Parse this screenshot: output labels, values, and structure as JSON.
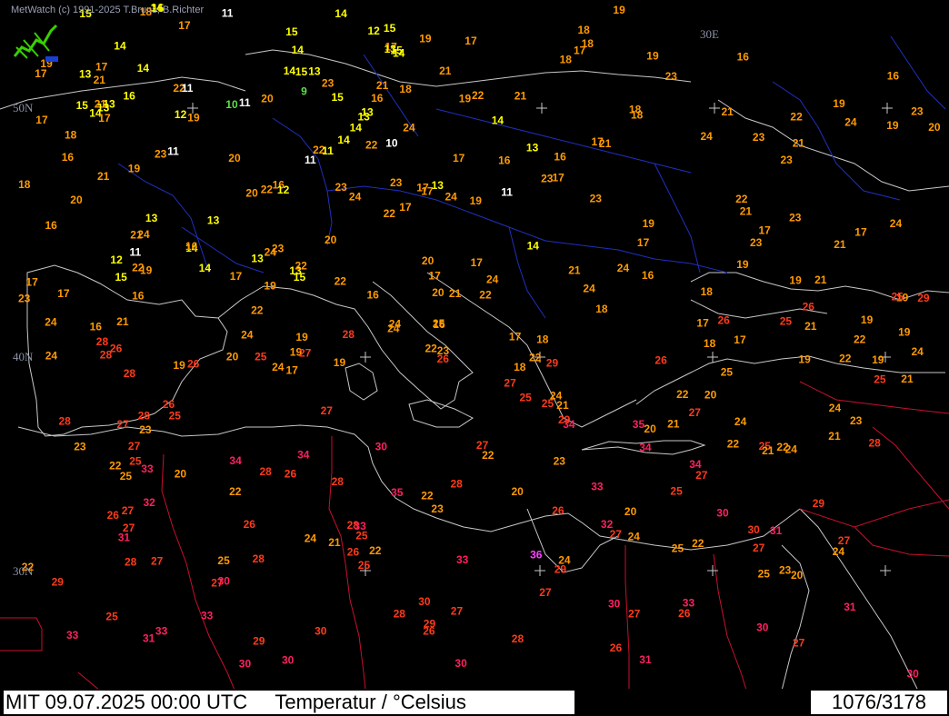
{
  "credit": "MetWatch  (c) 1991-2025 T.Bruns, B.Richter",
  "grid_labels": {
    "lon_30e": "30E",
    "lat_50n": "50N",
    "lat_40n": "40N",
    "lat_30n": "30N"
  },
  "footer": {
    "run_text": "MIT 09.07.2025 00:00 UTC     Temperatur / °Celsius",
    "count": "1076/3178"
  },
  "colors": {
    "background": "#000000",
    "coastline": "#c8c8c8",
    "borders_africa": "#c8102e",
    "borders_europe": "#2030c0",
    "temp_le_10": "#ffffff",
    "temp_green": "#5be04a",
    "temp_10_15": "#ffff00",
    "temp_16_19": "#ff9a00",
    "temp_20_24": "#ff8a00",
    "temp_25_29": "#ff3a1a",
    "temp_30_34": "#ff2060",
    "temp_ge_35": "#ff40ff"
  },
  "temperatures": [
    {
      "v": "11",
      "c": "w"
    },
    {
      "v": "16",
      "c": "y"
    },
    {
      "v": "17",
      "c": "o"
    },
    {
      "v": "16",
      "c": "o"
    },
    {
      "v": "16",
      "c": "o"
    },
    {
      "v": "13",
      "c": "y"
    },
    {
      "v": "15",
      "c": "y"
    },
    {
      "v": "13",
      "c": "y"
    },
    {
      "v": "15",
      "c": "y"
    },
    {
      "v": "14",
      "c": "y"
    },
    {
      "v": "17",
      "c": "o"
    },
    {
      "v": "19",
      "c": "o"
    },
    {
      "v": "19",
      "c": "o"
    },
    {
      "v": "16",
      "c": "o"
    },
    {
      "v": "17",
      "c": "o"
    },
    {
      "v": "18",
      "c": "o"
    },
    {
      "v": "19",
      "c": "o"
    },
    {
      "v": "14",
      "c": "y"
    },
    {
      "v": "15",
      "c": "y"
    },
    {
      "v": "13",
      "c": "y"
    },
    {
      "v": "11",
      "c": "w"
    },
    {
      "v": "12",
      "c": "y"
    },
    {
      "v": "14",
      "c": "y"
    },
    {
      "v": "15",
      "c": "y"
    },
    {
      "v": "13",
      "c": "y"
    },
    {
      "v": "13",
      "c": "y"
    },
    {
      "v": "14",
      "c": "y"
    },
    {
      "v": "15",
      "c": "y"
    },
    {
      "v": "16",
      "c": "o"
    },
    {
      "v": "17",
      "c": "o"
    },
    {
      "v": "19",
      "c": "o"
    },
    {
      "v": "17",
      "c": "o"
    },
    {
      "v": "22",
      "c": "o"
    },
    {
      "v": "20",
      "c": "o"
    },
    {
      "v": "22",
      "c": "o"
    },
    {
      "v": "24",
      "c": "o"
    },
    {
      "v": "19",
      "c": "o"
    },
    {
      "v": "19",
      "c": "o"
    },
    {
      "v": "19",
      "c": "o"
    },
    {
      "v": "20",
      "c": "o"
    },
    {
      "v": "14",
      "c": "y"
    },
    {
      "v": "10",
      "c": "g"
    },
    {
      "v": "12",
      "c": "y"
    },
    {
      "v": "16",
      "c": "o"
    },
    {
      "v": "14",
      "c": "y"
    },
    {
      "v": "15",
      "c": "y"
    },
    {
      "v": "14",
      "c": "y"
    },
    {
      "v": "15",
      "c": "y"
    },
    {
      "v": "16",
      "c": "o"
    },
    {
      "v": "17",
      "c": "o"
    },
    {
      "v": "16",
      "c": "o"
    },
    {
      "v": "19",
      "c": "o"
    },
    {
      "v": "19",
      "c": "o"
    },
    {
      "v": "21",
      "c": "o"
    },
    {
      "v": "20",
      "c": "o"
    },
    {
      "v": "22",
      "c": "o"
    },
    {
      "v": "22",
      "c": "o"
    },
    {
      "v": "21",
      "c": "o"
    },
    {
      "v": "20",
      "c": "o"
    },
    {
      "v": "21",
      "c": "o"
    },
    {
      "v": "22",
      "c": "o"
    },
    {
      "v": "16",
      "c": "o"
    },
    {
      "v": "13",
      "c": "y"
    },
    {
      "v": "11",
      "c": "w"
    },
    {
      "v": "16",
      "c": "o"
    },
    {
      "v": "14",
      "c": "y"
    },
    {
      "v": "12",
      "c": "y"
    },
    {
      "v": "17",
      "c": "o"
    },
    {
      "v": "17",
      "c": "o"
    },
    {
      "v": "17",
      "c": "o"
    },
    {
      "v": "17",
      "c": "o"
    },
    {
      "v": "21",
      "c": "o"
    },
    {
      "v": "22",
      "c": "o"
    },
    {
      "v": "24",
      "c": "o"
    },
    {
      "v": "25",
      "c": "r"
    },
    {
      "v": "21",
      "c": "o"
    },
    {
      "v": "19",
      "c": "o"
    },
    {
      "v": "16",
      "c": "o"
    },
    {
      "v": "20",
      "c": "o"
    },
    {
      "v": "17",
      "c": "o"
    },
    {
      "v": "16",
      "c": "o"
    },
    {
      "v": "11",
      "c": "w"
    },
    {
      "v": "10",
      "c": "w"
    },
    {
      "v": "11",
      "c": "w"
    },
    {
      "v": "13",
      "c": "y"
    },
    {
      "v": "14",
      "c": "y"
    },
    {
      "v": "17",
      "c": "o"
    },
    {
      "v": "17",
      "c": "o"
    },
    {
      "v": "18",
      "c": "o"
    },
    {
      "v": "18",
      "c": "o"
    },
    {
      "v": "25",
      "c": "o"
    },
    {
      "v": "24",
      "c": "o"
    },
    {
      "v": "24",
      "c": "o"
    },
    {
      "v": "18",
      "c": "o"
    },
    {
      "v": "22",
      "c": "o"
    },
    {
      "v": "21",
      "c": "o"
    },
    {
      "v": "13",
      "c": "y"
    },
    {
      "v": "15",
      "c": "y"
    },
    {
      "v": "13",
      "c": "y"
    },
    {
      "v": "14",
      "c": "y"
    },
    {
      "v": "11",
      "c": "w"
    },
    {
      "v": "11",
      "c": "w"
    },
    {
      "v": "13",
      "c": "y"
    },
    {
      "v": "14",
      "c": "y"
    },
    {
      "v": "16",
      "c": "o"
    },
    {
      "v": "17",
      "c": "o"
    },
    {
      "v": "19",
      "c": "o"
    },
    {
      "v": "21",
      "c": "o"
    },
    {
      "v": "23",
      "c": "o"
    },
    {
      "v": "22",
      "c": "o"
    },
    {
      "v": "22",
      "c": "o"
    },
    {
      "v": "17",
      "c": "o"
    },
    {
      "v": "19",
      "c": "o"
    },
    {
      "v": "24",
      "c": "o"
    },
    {
      "v": "23",
      "c": "o"
    },
    {
      "v": "23",
      "c": "o"
    },
    {
      "v": "23",
      "c": "o"
    },
    {
      "v": "24",
      "c": "o"
    },
    {
      "v": "23",
      "c": "o"
    },
    {
      "v": "21",
      "c": "o"
    },
    {
      "v": "27",
      "c": "r"
    },
    {
      "v": "26",
      "c": "r"
    },
    {
      "v": "25",
      "c": "r"
    },
    {
      "v": "23",
      "c": "o"
    },
    {
      "v": "27",
      "c": "r"
    },
    {
      "v": "26",
      "c": "r"
    },
    {
      "v": "24",
      "c": "o"
    },
    {
      "v": "22",
      "c": "o"
    },
    {
      "v": "25",
      "c": "r"
    },
    {
      "v": "21",
      "c": "o"
    },
    {
      "v": "19",
      "c": "o"
    },
    {
      "v": "24",
      "c": "o"
    },
    {
      "v": "23",
      "c": "o"
    },
    {
      "v": "22",
      "c": "o"
    },
    {
      "v": "17",
      "c": "o"
    },
    {
      "v": "19",
      "c": "o"
    },
    {
      "v": "24",
      "c": "o"
    },
    {
      "v": "23",
      "c": "o"
    },
    {
      "v": "21",
      "c": "o"
    },
    {
      "v": "20",
      "c": "o"
    },
    {
      "v": "22",
      "c": "o"
    },
    {
      "v": "22",
      "c": "o"
    },
    {
      "v": "22",
      "c": "o"
    },
    {
      "v": "11",
      "c": "y"
    },
    {
      "v": "13",
      "c": "y"
    },
    {
      "v": "14",
      "c": "y"
    },
    {
      "v": "13",
      "c": "y"
    },
    {
      "v": "18",
      "c": "o"
    },
    {
      "v": "23",
      "c": "o"
    },
    {
      "v": "19",
      "c": "o"
    },
    {
      "v": "21",
      "c": "o"
    },
    {
      "v": "20",
      "c": "o"
    },
    {
      "v": "18",
      "c": "o"
    },
    {
      "v": "19",
      "c": "o"
    },
    {
      "v": "17",
      "c": "o"
    },
    {
      "v": "21",
      "c": "o"
    },
    {
      "v": "14",
      "c": "y"
    },
    {
      "v": "9",
      "c": "g"
    },
    {
      "v": "24",
      "c": "o"
    },
    {
      "v": "23",
      "c": "o"
    },
    {
      "v": "21",
      "c": "o"
    },
    {
      "v": "17",
      "c": "o"
    },
    {
      "v": "18",
      "c": "o"
    },
    {
      "v": "21",
      "c": "o"
    },
    {
      "v": "18",
      "c": "o"
    },
    {
      "v": "17",
      "c": "o"
    },
    {
      "v": "12",
      "c": "y"
    },
    {
      "v": "14",
      "c": "y"
    },
    {
      "v": "15",
      "c": "y"
    },
    {
      "v": "20",
      "c": "o"
    },
    {
      "v": "19",
      "c": "o"
    },
    {
      "v": "18",
      "c": "o"
    },
    {
      "v": "17",
      "c": "o"
    },
    {
      "v": "18",
      "c": "o"
    },
    {
      "v": "17",
      "c": "o"
    },
    {
      "v": "19",
      "c": "o"
    },
    {
      "v": "18",
      "c": "o"
    },
    {
      "v": "20",
      "c": "o"
    },
    {
      "v": "13",
      "c": "y"
    },
    {
      "v": "21",
      "c": "o"
    },
    {
      "v": "20",
      "c": "o"
    },
    {
      "v": "19",
      "c": "o"
    },
    {
      "v": "28",
      "c": "r"
    },
    {
      "v": "27",
      "c": "r"
    },
    {
      "v": "26",
      "c": "r"
    },
    {
      "v": "25",
      "c": "r"
    },
    {
      "v": "28",
      "c": "r"
    },
    {
      "v": "27",
      "c": "r"
    },
    {
      "v": "30",
      "c": "r"
    },
    {
      "v": "28",
      "c": "r"
    },
    {
      "v": "27",
      "c": "r"
    },
    {
      "v": "25",
      "c": "r"
    },
    {
      "v": "24",
      "c": "o"
    },
    {
      "v": "22",
      "c": "o"
    },
    {
      "v": "24",
      "c": "o"
    },
    {
      "v": "27",
      "c": "r"
    },
    {
      "v": "21",
      "c": "o"
    },
    {
      "v": "18",
      "c": "o"
    },
    {
      "v": "24",
      "c": "o"
    },
    {
      "v": "25",
      "c": "o"
    },
    {
      "v": "25",
      "c": "r"
    },
    {
      "v": "26",
      "c": "r"
    },
    {
      "v": "22",
      "c": "o"
    },
    {
      "v": "23",
      "c": "o"
    },
    {
      "v": "27",
      "c": "r"
    },
    {
      "v": "24",
      "c": "o"
    },
    {
      "v": "22",
      "c": "o"
    },
    {
      "v": "29",
      "c": "r"
    },
    {
      "v": "30",
      "c": "r"
    },
    {
      "v": "21",
      "c": "o"
    },
    {
      "v": "19",
      "c": "o"
    },
    {
      "v": "25",
      "c": "r"
    },
    {
      "v": "22",
      "c": "o"
    },
    {
      "v": "23",
      "c": "o"
    },
    {
      "v": "21",
      "c": "o"
    },
    {
      "v": "16",
      "c": "o"
    },
    {
      "v": "20",
      "c": "o"
    },
    {
      "v": "26",
      "c": "r"
    },
    {
      "v": "28",
      "c": "r"
    },
    {
      "v": "31",
      "c": "p"
    },
    {
      "v": "30",
      "c": "p"
    },
    {
      "v": "27",
      "c": "r"
    },
    {
      "v": "22",
      "c": "o"
    },
    {
      "v": "33",
      "c": "p"
    },
    {
      "v": "29",
      "c": "r"
    },
    {
      "v": "28",
      "c": "r"
    },
    {
      "v": "32",
      "c": "p"
    },
    {
      "v": "22",
      "c": "o"
    },
    {
      "v": "18",
      "c": "o"
    },
    {
      "v": "17",
      "c": "o"
    },
    {
      "v": "19",
      "c": "o"
    },
    {
      "v": "17",
      "c": "o"
    },
    {
      "v": "17",
      "c": "o"
    },
    {
      "v": "15",
      "c": "y"
    },
    {
      "v": "20",
      "c": "o"
    },
    {
      "v": "17",
      "c": "o"
    },
    {
      "v": "22",
      "c": "o"
    },
    {
      "v": "25",
      "c": "o"
    },
    {
      "v": "24",
      "c": "o"
    },
    {
      "v": "25",
      "c": "o"
    },
    {
      "v": "24",
      "c": "o"
    },
    {
      "v": "24",
      "c": "o"
    },
    {
      "v": "23",
      "c": "o"
    },
    {
      "v": "24",
      "c": "o"
    },
    {
      "v": "22",
      "c": "o"
    },
    {
      "v": "23",
      "c": "o"
    },
    {
      "v": "19",
      "c": "o"
    },
    {
      "v": "20",
      "c": "o"
    },
    {
      "v": "18",
      "c": "o"
    },
    {
      "v": "23",
      "c": "o"
    },
    {
      "v": "16",
      "c": "o"
    },
    {
      "v": "24",
      "c": "o"
    },
    {
      "v": "25",
      "c": "r"
    },
    {
      "v": "27",
      "c": "r"
    },
    {
      "v": "23",
      "c": "o"
    },
    {
      "v": "25",
      "c": "o"
    },
    {
      "v": "26",
      "c": "r"
    },
    {
      "v": "27",
      "c": "r"
    },
    {
      "v": "25",
      "c": "r"
    },
    {
      "v": "21",
      "c": "o"
    },
    {
      "v": "24",
      "c": "o"
    },
    {
      "v": "19",
      "c": "o"
    },
    {
      "v": "17",
      "c": "o"
    },
    {
      "v": "20",
      "c": "o"
    },
    {
      "v": "21",
      "c": "o"
    },
    {
      "v": "22",
      "c": "o"
    },
    {
      "v": "24",
      "c": "o"
    },
    {
      "v": "25",
      "c": "r"
    },
    {
      "v": "23",
      "c": "o"
    },
    {
      "v": "26",
      "c": "r"
    },
    {
      "v": "28",
      "c": "r"
    },
    {
      "v": "26",
      "c": "r"
    },
    {
      "v": "28",
      "c": "r"
    },
    {
      "v": "27",
      "c": "r"
    },
    {
      "v": "28",
      "c": "r"
    },
    {
      "v": "26",
      "c": "r"
    },
    {
      "v": "27",
      "c": "r"
    },
    {
      "v": "24",
      "c": "o"
    },
    {
      "v": "21",
      "c": "o"
    },
    {
      "v": "22",
      "c": "o"
    },
    {
      "v": "28",
      "c": "r"
    },
    {
      "v": "28",
      "c": "r"
    },
    {
      "v": "27",
      "c": "r"
    },
    {
      "v": "27",
      "c": "r"
    },
    {
      "v": "26",
      "c": "r"
    },
    {
      "v": "25",
      "c": "r"
    },
    {
      "v": "29",
      "c": "r"
    },
    {
      "v": "31",
      "c": "p"
    },
    {
      "v": "28",
      "c": "r"
    },
    {
      "v": "33",
      "c": "p"
    },
    {
      "v": "29",
      "c": "r"
    },
    {
      "v": "27",
      "c": "r"
    },
    {
      "v": "30",
      "c": "p"
    },
    {
      "v": "20",
      "c": "o"
    },
    {
      "v": "21",
      "c": "o"
    },
    {
      "v": "24",
      "c": "o"
    },
    {
      "v": "28",
      "c": "r"
    },
    {
      "v": "23",
      "c": "o"
    },
    {
      "v": "31",
      "c": "p"
    },
    {
      "v": "30",
      "c": "p"
    },
    {
      "v": "33",
      "c": "p"
    },
    {
      "v": "34",
      "c": "p"
    },
    {
      "v": "34",
      "c": "p"
    },
    {
      "v": "33",
      "c": "p"
    },
    {
      "v": "35",
      "c": "p"
    },
    {
      "v": "30",
      "c": "p"
    },
    {
      "v": "32",
      "c": "p"
    },
    {
      "v": "29",
      "c": "r"
    },
    {
      "v": "36",
      "c": "m"
    },
    {
      "v": "30",
      "c": "p"
    },
    {
      "v": "34",
      "c": "p"
    },
    {
      "v": "33",
      "c": "p"
    },
    {
      "v": "35",
      "c": "p"
    },
    {
      "v": "34",
      "c": "p"
    },
    {
      "v": "30",
      "c": "p"
    },
    {
      "v": "33",
      "c": "p"
    },
    {
      "v": "27",
      "c": "r"
    },
    {
      "v": "34",
      "c": "p"
    },
    {
      "v": "23",
      "c": "o"
    },
    {
      "v": "25",
      "c": "r"
    },
    {
      "v": "24",
      "c": "o"
    },
    {
      "v": "24",
      "c": "o"
    },
    {
      "v": "26",
      "c": "r"
    },
    {
      "v": "26",
      "c": "r"
    },
    {
      "v": "24",
      "c": "o"
    },
    {
      "v": "25",
      "c": "o"
    },
    {
      "v": "27",
      "c": "r"
    },
    {
      "v": "28",
      "c": "r"
    },
    {
      "v": "30",
      "c": "p"
    },
    {
      "v": "26",
      "c": "r"
    },
    {
      "v": "31",
      "c": "p"
    },
    {
      "v": "33",
      "c": "p"
    },
    {
      "v": "28",
      "c": "r"
    },
    {
      "v": "29",
      "c": "r"
    },
    {
      "v": "29",
      "c": "r"
    },
    {
      "v": "27",
      "c": "r"
    },
    {
      "v": "26",
      "c": "r"
    },
    {
      "v": "30",
      "c": "p"
    },
    {
      "v": "22",
      "c": "o"
    },
    {
      "v": "19",
      "c": "o"
    },
    {
      "v": "21",
      "c": "o"
    },
    {
      "v": "30",
      "c": "r"
    },
    {
      "v": "29",
      "c": "r"
    },
    {
      "v": "23",
      "c": "o"
    },
    {
      "v": "25",
      "c": "r"
    },
    {
      "v": "22",
      "c": "o"
    },
    {
      "v": "28",
      "c": "r"
    },
    {
      "v": "31",
      "c": "p"
    },
    {
      "v": "23",
      "c": "o"
    },
    {
      "v": "26",
      "c": "r"
    },
    {
      "v": "27",
      "c": "r"
    },
    {
      "v": "30",
      "c": "p"
    },
    {
      "v": "22",
      "c": "o"
    },
    {
      "v": "33",
      "c": "p"
    }
  ]
}
